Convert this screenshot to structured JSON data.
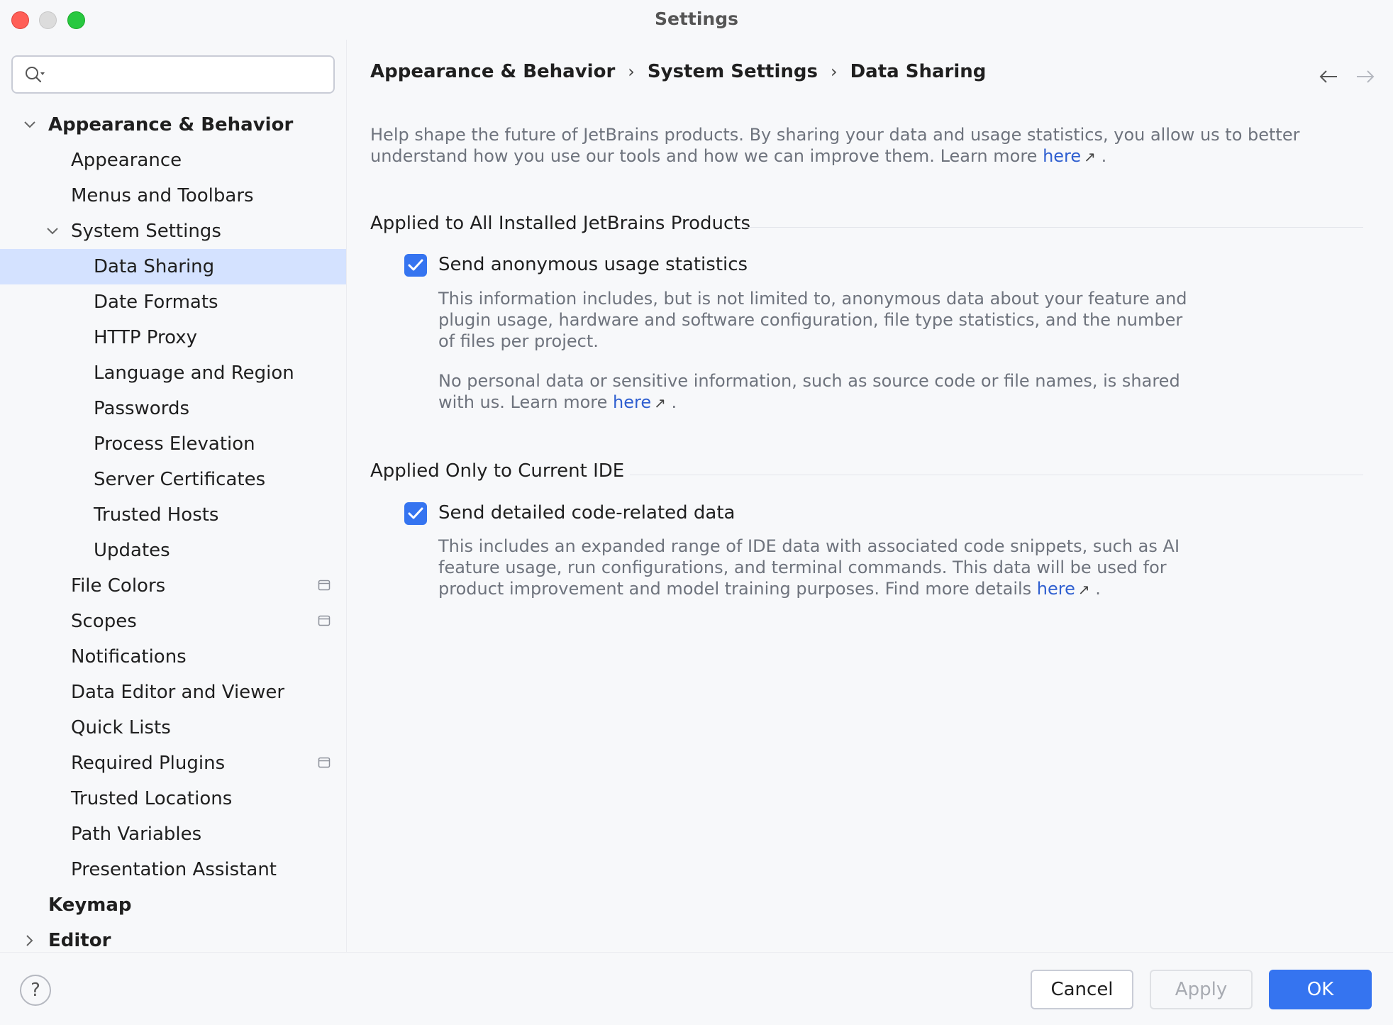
{
  "window": {
    "title": "Settings"
  },
  "search": {
    "placeholder": ""
  },
  "sidebar": {
    "items": [
      {
        "label": "Appearance & Behavior",
        "level": 0,
        "expanded": true,
        "bold": true
      },
      {
        "label": "Appearance",
        "level": 1
      },
      {
        "label": "Menus and Toolbars",
        "level": 1
      },
      {
        "label": "System Settings",
        "level": 1,
        "expanded": true
      },
      {
        "label": "Data Sharing",
        "level": 2,
        "selected": true
      },
      {
        "label": "Date Formats",
        "level": 2
      },
      {
        "label": "HTTP Proxy",
        "level": 2
      },
      {
        "label": "Language and Region",
        "level": 2
      },
      {
        "label": "Passwords",
        "level": 2
      },
      {
        "label": "Process Elevation",
        "level": 2
      },
      {
        "label": "Server Certificates",
        "level": 2
      },
      {
        "label": "Trusted Hosts",
        "level": 2
      },
      {
        "label": "Updates",
        "level": 2
      },
      {
        "label": "File Colors",
        "level": 1,
        "project_icon": true
      },
      {
        "label": "Scopes",
        "level": 1,
        "project_icon": true
      },
      {
        "label": "Notifications",
        "level": 1
      },
      {
        "label": "Data Editor and Viewer",
        "level": 1
      },
      {
        "label": "Quick Lists",
        "level": 1
      },
      {
        "label": "Required Plugins",
        "level": 1,
        "project_icon": true
      },
      {
        "label": "Trusted Locations",
        "level": 1
      },
      {
        "label": "Path Variables",
        "level": 1
      },
      {
        "label": "Presentation Assistant",
        "level": 1
      },
      {
        "label": "Keymap",
        "level": 0,
        "bold": true
      },
      {
        "label": "Editor",
        "level": 0,
        "bold": true,
        "collapsed": true
      }
    ]
  },
  "breadcrumb": {
    "items": [
      "Appearance & Behavior",
      "System Settings",
      "Data Sharing"
    ],
    "separator": "›"
  },
  "icons": {
    "back": "arrow-left-icon",
    "forward": "arrow-right-icon",
    "external": "external-link-icon",
    "check": "check-icon",
    "search": "search-icon",
    "help": "help-icon"
  },
  "main": {
    "intro_text": "Help shape the future of JetBrains products. By sharing your data and usage statistics, you allow us to better understand how you use our tools and how we can improve them. Learn more ",
    "intro_link": "here",
    "intro_end": ".",
    "section1": {
      "title": "Applied to All Installed JetBrains Products",
      "checkbox_label": "Send anonymous usage statistics",
      "checked": true,
      "desc1": "This information includes, but is not limited to, anonymous data about your feature and plugin usage, hardware and software configuration, file type statistics, and the number of files per project.",
      "desc2": "No personal data or sensitive information, such as source code or file names, is shared with us. Learn more ",
      "desc2_link": "here",
      "desc2_end": "."
    },
    "section2": {
      "title": "Applied Only to Current IDE",
      "checkbox_label": "Send detailed code-related data",
      "checked": true,
      "desc": "This includes an expanded range of IDE data with associated code snippets, such as AI feature usage, run configurations, and terminal commands. This data will be used for product improvement and model training purposes. Find more details ",
      "desc_link": "here",
      "desc_end": "."
    }
  },
  "footer": {
    "help_label": "?",
    "cancel": "Cancel",
    "apply": "Apply",
    "ok": "OK"
  },
  "colors": {
    "accent": "#3574f0",
    "selection": "#d4e2ff",
    "link": "#2f5fd0",
    "muted_text": "#6e737d"
  }
}
